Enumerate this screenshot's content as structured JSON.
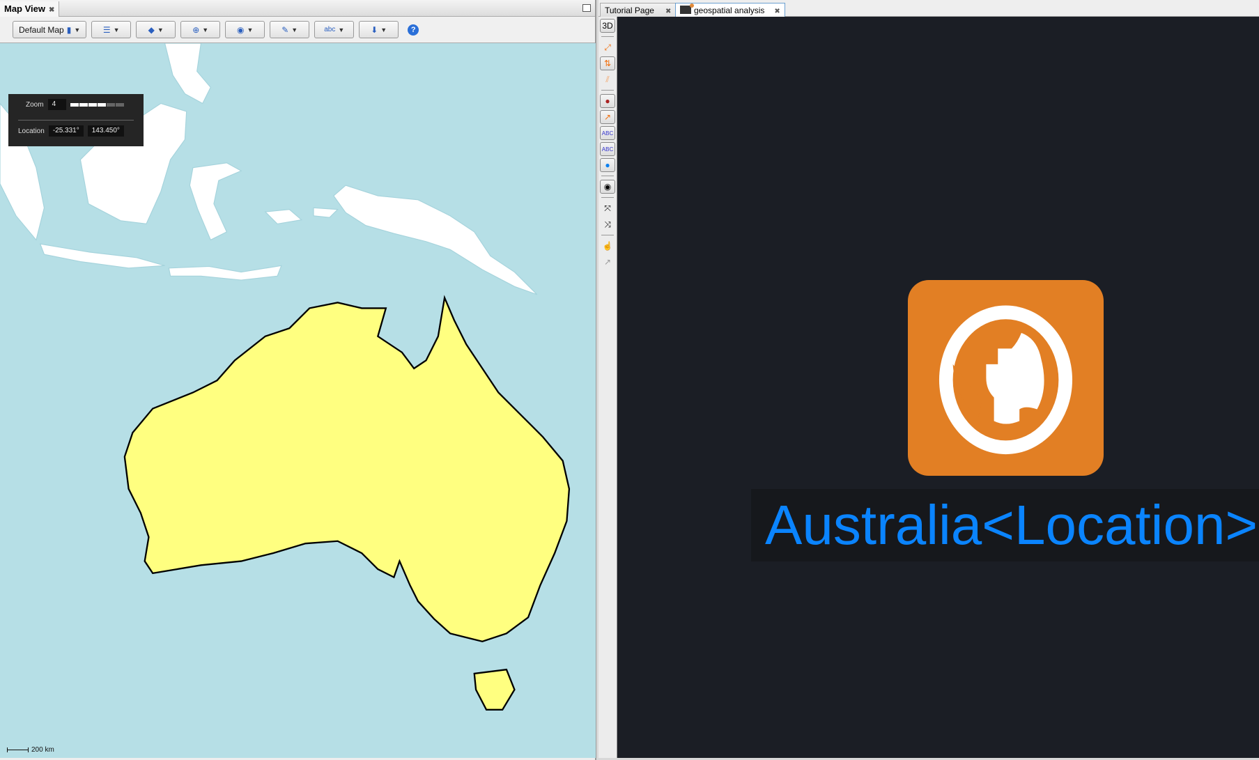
{
  "left_panel": {
    "tab_title": "Map View",
    "toolbar": {
      "map_selector_label": "Default Map",
      "buttons": [
        "layers-menu",
        "tags-menu",
        "zoom-menu",
        "visibility-menu",
        "draw-menu",
        "labels-menu",
        "export-menu"
      ],
      "labels_button_text": "abc",
      "help_label": "?"
    },
    "overlay": {
      "zoom_label": "Zoom",
      "zoom_value": "4",
      "zoom_level_fraction": 0.67,
      "location_label": "Location",
      "latitude": "-25.331°",
      "longitude": "143.450°"
    },
    "scale_bar": "200 km",
    "colors": {
      "water": "#b6dfe6",
      "land": "#ffffff",
      "highlight": "#ffff80"
    }
  },
  "right_panel": {
    "tabs": [
      {
        "label": "Tutorial Page",
        "active": false
      },
      {
        "label": "geospatial analysis",
        "active": true
      }
    ],
    "side_tools": {
      "three_d_label": "3D",
      "abc_label": "ABC"
    },
    "node_label": "Australia<Location>",
    "colors": {
      "background": "#1b1e25",
      "logo": "#e27f24",
      "label": "#0a84ff"
    }
  }
}
